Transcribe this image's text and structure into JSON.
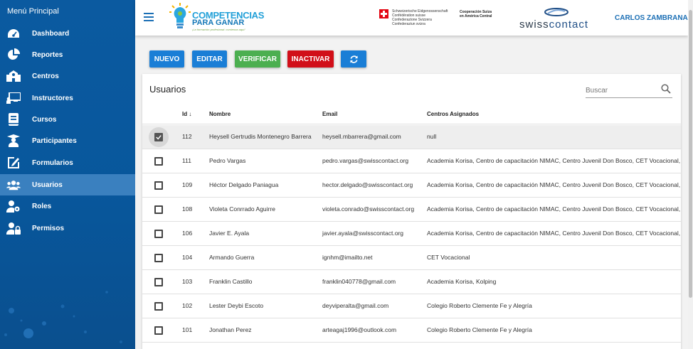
{
  "sidebar": {
    "title": "Menú Principal",
    "items": [
      {
        "label": "Dashboard",
        "icon": "dashboard-icon"
      },
      {
        "label": "Reportes",
        "icon": "pie-chart-icon"
      },
      {
        "label": "Centros",
        "icon": "school-icon"
      },
      {
        "label": "Instructores",
        "icon": "presentation-icon"
      },
      {
        "label": "Cursos",
        "icon": "book-icon"
      },
      {
        "label": "Participantes",
        "icon": "graduate-icon"
      },
      {
        "label": "Formularios",
        "icon": "edit-icon"
      },
      {
        "label": "Usuarios",
        "icon": "users-icon",
        "active": true
      },
      {
        "label": "Roles",
        "icon": "user-cog-icon"
      },
      {
        "label": "Permisos",
        "icon": "user-lock-icon"
      }
    ]
  },
  "header": {
    "brand_line1": "COMPETENCIAS",
    "brand_line2": "PARA GANAR",
    "brand_tagline": "¡La formación profesional: comienza aquí!",
    "swiss_lines": [
      "Schweizerische Eidgenossenschaft",
      "Confédération suisse",
      "Confederazione Svizzera",
      "Confederaziun svizra"
    ],
    "coop_lines": [
      "Cooperación Suiza",
      "en América Central"
    ],
    "partner_logo_a": "swiss",
    "partner_logo_b": "contact",
    "user_name": "CARLOS ZAMBRANA"
  },
  "toolbar": {
    "new_label": "NUEVO",
    "edit_label": "EDITAR",
    "verify_label": "VERIFICAR",
    "deactivate_label": "INACTIVAR",
    "refresh_icon": "refresh-icon"
  },
  "colors": {
    "new": "#1a7ed6",
    "edit": "#1a7ed6",
    "verify": "#4caf50",
    "deactivate": "#d10f19",
    "refresh": "#1a7ed6",
    "sidebar": "#0b5aa0",
    "active_item": "#3a80bf"
  },
  "table": {
    "title": "Usuarios",
    "search_placeholder": "Buscar",
    "sort_indicator": "↓",
    "columns": {
      "id": "Id",
      "name": "Nombre",
      "email": "Email",
      "centers": "Centros Asignados"
    },
    "rows": [
      {
        "id": "112",
        "name": "Heysell Gertrudis Montenegro Barrera",
        "email": "heysell.mbarrera@gmail.com",
        "centers": "null",
        "checked": true
      },
      {
        "id": "111",
        "name": "Pedro Vargas",
        "email": "pedro.vargas@swisscontact.org",
        "centers": "Academia Korisa, Centro de capacitación NIMAC, Centro Juvenil Don Bosco, CET Vocacional, Cole",
        "checked": false
      },
      {
        "id": "109",
        "name": "Héctor Delgado Paniagua",
        "email": "hector.delgado@swisscontact.org",
        "centers": "Academia Korisa, Centro de capacitación NIMAC, Centro Juvenil Don Bosco, CET Vocacional, Cole",
        "checked": false
      },
      {
        "id": "108",
        "name": "Violeta Conrrado Aguirre",
        "email": "violeta.conrado@swisscontact.org",
        "centers": "Academia Korisa, Centro de capacitación NIMAC, Centro Juvenil Don Bosco, CET Vocacional, Cole",
        "checked": false
      },
      {
        "id": "106",
        "name": "Javier E. Ayala",
        "email": "javier.ayala@swisscontact.org",
        "centers": "Academia Korisa, Centro de capacitación NIMAC, Centro Juvenil Don Bosco, CET Vocacional, Cole",
        "checked": false
      },
      {
        "id": "104",
        "name": "Armando Guerra",
        "email": "ignhm@imailto.net",
        "centers": "CET Vocacional",
        "checked": false
      },
      {
        "id": "103",
        "name": "Franklin Castillo",
        "email": "franklin040778@gmail.com",
        "centers": "Academia Korisa, Kolping",
        "checked": false
      },
      {
        "id": "102",
        "name": "Lester Deybi Escoto",
        "email": "deyviperalta@gmail.com",
        "centers": "Colegio Roberto Clemente Fe y Alegría",
        "checked": false
      },
      {
        "id": "101",
        "name": "Jonathan Perez",
        "email": "arteagaj1996@outlook.com",
        "centers": "Colegio Roberto Clemente Fe y Alegría",
        "checked": false
      }
    ]
  }
}
